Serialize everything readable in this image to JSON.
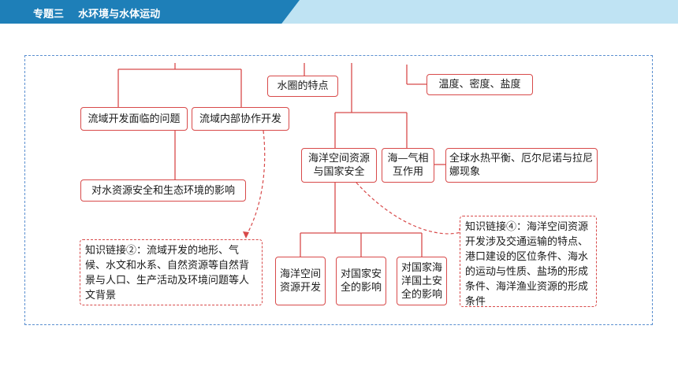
{
  "header": {
    "title": "专题三    水环境与水体运动",
    "bg_color": "#bfe3f3",
    "tab_color": "#1e7fb8"
  },
  "diagram": {
    "nodes": {
      "water_features": "水圈的特点",
      "temp_density_salinity": "温度、密度、盐度",
      "basin_problems": "流域开发面临的问题",
      "basin_cooperation": "流域内部协作开发",
      "ocean_security": "海洋空间资源与国家安全",
      "air_sea": "海—气相互作用",
      "global_balance": "全球水热平衡、厄尔尼诺与拉尼娜现象",
      "water_security_impact": "对水资源安全和生态环境的影响",
      "ocean_dev": "海洋空间资源开发",
      "national_security_impact": "对国家安全的影响",
      "territory_security_impact": "对国家海洋国土安全的影响"
    },
    "links": {
      "link2": "知识链接②：流域开发的地形、气候、水文和水系、自然资源等自然背景与人口、生产活动及环境问题等人文背景",
      "link4": "知识链接④：海洋空间资源开发涉及交通运输的特点、港口建设的区位条件、海水的运动与性质、盐场的形成条件、海洋渔业资源的形成条件"
    },
    "colors": {
      "line": "#d84a4a",
      "frame": "#5a8fd0"
    }
  }
}
